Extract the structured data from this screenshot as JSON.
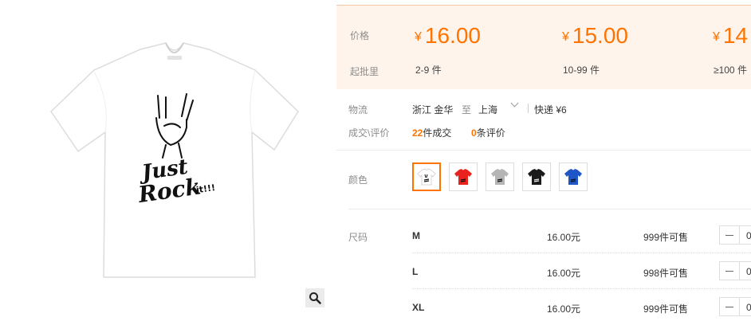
{
  "image": {
    "zoom_icon": "magnifier-icon",
    "product": "white t-shirt with rock hand print"
  },
  "price_table": {
    "price_label": "价格",
    "moq_label": "起批里",
    "tiers": [
      {
        "currency": "¥",
        "price": "16.00",
        "range": "2-9 件"
      },
      {
        "currency": "¥",
        "price": "15.00",
        "range": "10-99 件"
      },
      {
        "currency": "¥",
        "price": "14",
        "range": "≥100 件"
      }
    ]
  },
  "logistics": {
    "label": "物流",
    "from": "浙江 金华",
    "to_word": "至",
    "to": "上海",
    "shipping": "快递 ¥6"
  },
  "deals": {
    "label": "成交\\评价",
    "deal_count": "22",
    "deal_suffix": "件成交",
    "review_count": "0",
    "review_suffix": "条评价"
  },
  "color": {
    "label": "颜色",
    "options": [
      {
        "name": "white",
        "hex": "#ffffff",
        "selected": true
      },
      {
        "name": "red",
        "hex": "#e8231d",
        "selected": false
      },
      {
        "name": "grey",
        "hex": "#b5b5b5",
        "selected": false
      },
      {
        "name": "black",
        "hex": "#1a1a1a",
        "selected": false
      },
      {
        "name": "blue",
        "hex": "#1e56c8",
        "selected": false
      }
    ]
  },
  "size": {
    "label": "尺码",
    "rows": [
      {
        "name": "M",
        "price": "16.00元",
        "stock": "999件可售",
        "qty": "0"
      },
      {
        "name": "L",
        "price": "16.00元",
        "stock": "998件可售",
        "qty": "0"
      },
      {
        "name": "XL",
        "price": "16.00元",
        "stock": "999件可售",
        "qty": "0"
      }
    ]
  },
  "colors": {
    "accent": "#ff7300",
    "price_bg": "#fff4ec"
  }
}
